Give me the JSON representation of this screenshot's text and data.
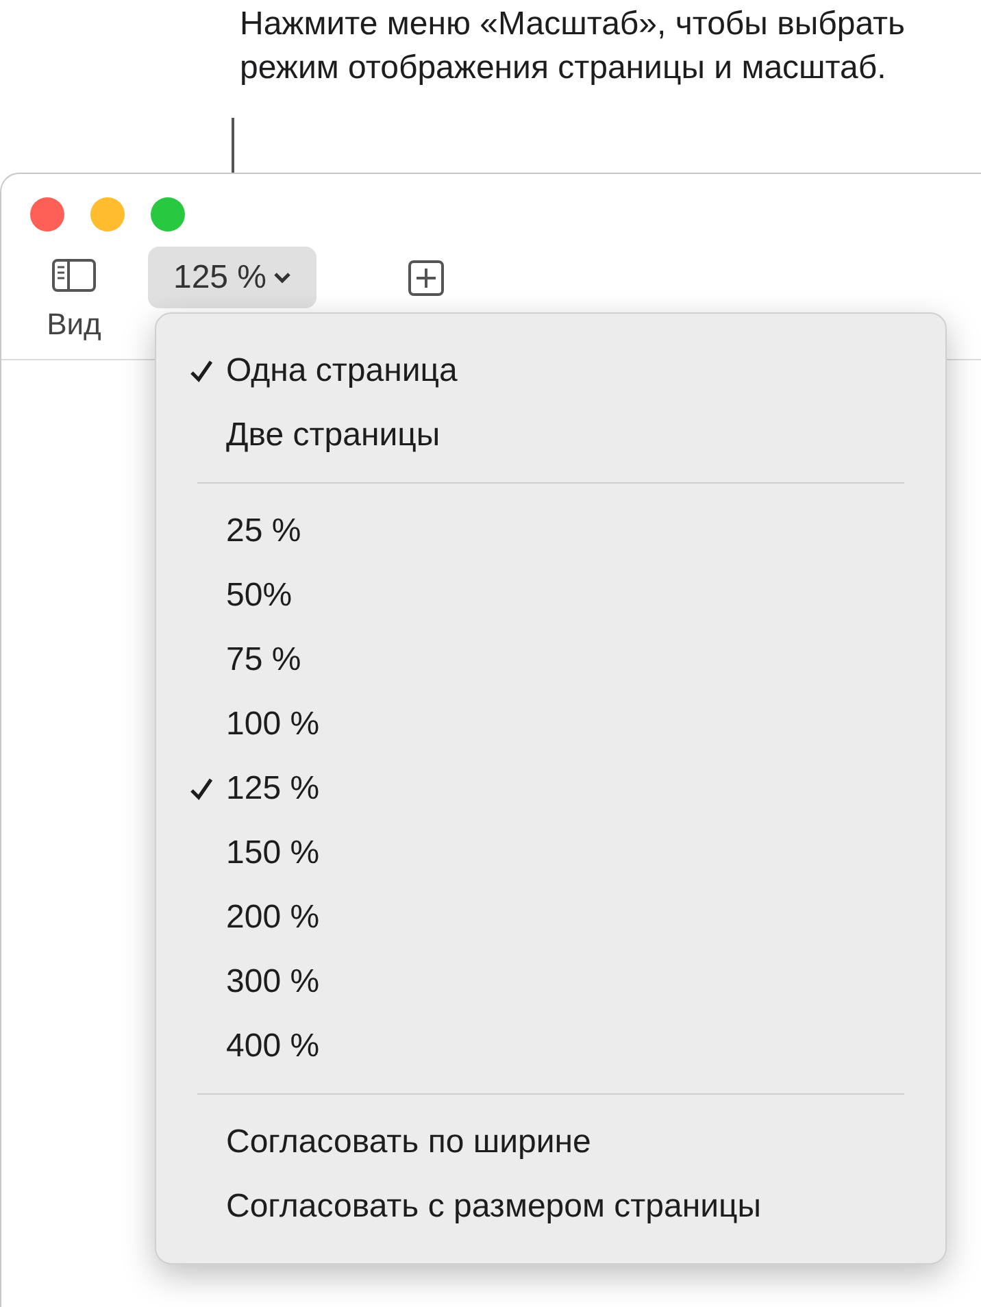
{
  "callout": {
    "text": "Нажмите меню «Масштаб», чтобы выбрать режим отображения страницы и масштаб."
  },
  "toolbar": {
    "view_label": "Вид",
    "zoom_button": {
      "label": "125 %",
      "expanded": true
    }
  },
  "menu": [
    {
      "kind": "item",
      "label": "Одна страница",
      "checked": true
    },
    {
      "kind": "item",
      "label": "Две страницы",
      "checked": false
    },
    {
      "kind": "separator"
    },
    {
      "kind": "item",
      "label": "25 %",
      "checked": false
    },
    {
      "kind": "item",
      "label": "50%",
      "checked": false
    },
    {
      "kind": "item",
      "label": "75 %",
      "checked": false
    },
    {
      "kind": "item",
      "label": "100 %",
      "checked": false
    },
    {
      "kind": "item",
      "label": "125 %",
      "checked": true
    },
    {
      "kind": "item",
      "label": "150 %",
      "checked": false
    },
    {
      "kind": "item",
      "label": "200 %",
      "checked": false
    },
    {
      "kind": "item",
      "label": "300 %",
      "checked": false
    },
    {
      "kind": "item",
      "label": "400 %",
      "checked": false
    },
    {
      "kind": "separator"
    },
    {
      "kind": "item",
      "label": "Согласовать по ширине",
      "checked": false
    },
    {
      "kind": "item",
      "label": "Согласовать с размером страницы",
      "checked": false
    }
  ]
}
